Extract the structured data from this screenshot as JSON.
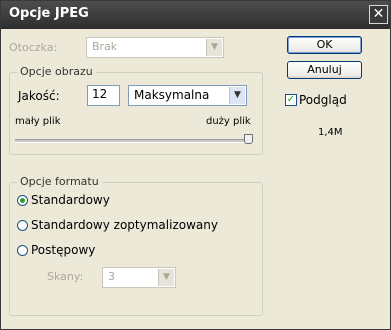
{
  "window": {
    "title": "Opcje JPEG",
    "close_glyph": "✕"
  },
  "matte": {
    "label": "Otoczka:",
    "value": "Brak"
  },
  "image_options": {
    "legend": "Opcje obrazu",
    "quality_label": "Jakość:",
    "quality_value": "12",
    "quality_preset": "Maksymalna",
    "small_label": "mały plik",
    "large_label": "duży plik",
    "slider_level": 1.0
  },
  "format_options": {
    "legend": "Opcje formatu",
    "options": [
      {
        "label": "Standardowy",
        "selected": true
      },
      {
        "label": "Standardowy zoptymalizowany",
        "selected": false
      },
      {
        "label": "Postępowy",
        "selected": false
      }
    ],
    "scans_label": "Skany:",
    "scans_value": "3"
  },
  "buttons": {
    "ok": "OK",
    "cancel": "Anuluj"
  },
  "preview": {
    "label": "Podgląd",
    "checked": true,
    "size": "1,4M"
  },
  "colors": {
    "titlebar": "#3a3a3a",
    "dialog": "#ece9d8",
    "radio_dot": "#2a9b2a"
  }
}
